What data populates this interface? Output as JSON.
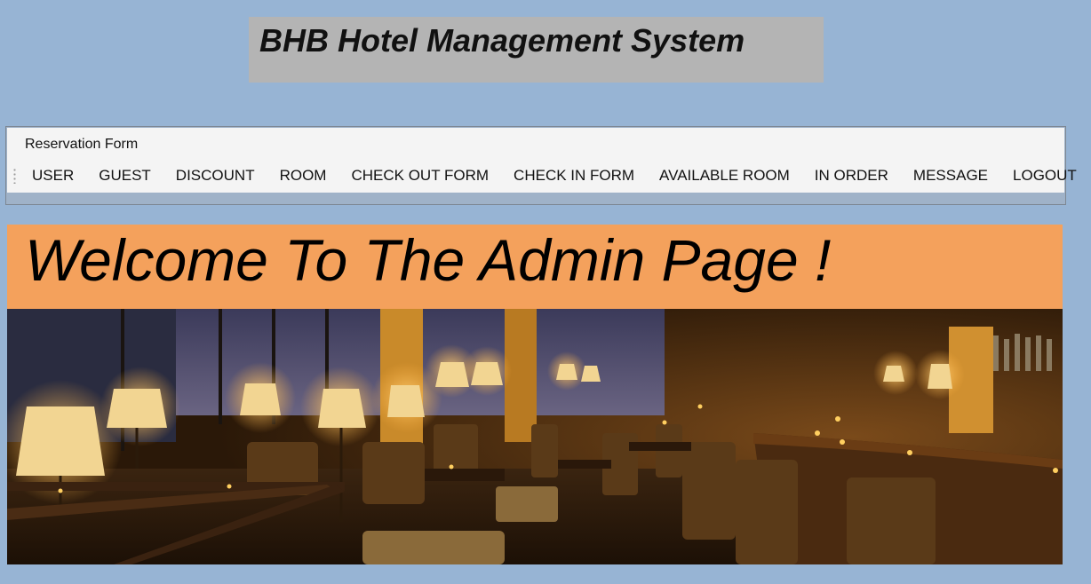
{
  "app": {
    "title": "BHB Hotel Management System"
  },
  "form": {
    "label": "Reservation Form"
  },
  "menu": {
    "items": [
      {
        "label": "USER",
        "name": "menu-user"
      },
      {
        "label": "GUEST",
        "name": "menu-guest"
      },
      {
        "label": "DISCOUNT",
        "name": "menu-discount"
      },
      {
        "label": "ROOM",
        "name": "menu-room"
      },
      {
        "label": "CHECK OUT FORM",
        "name": "menu-check-out-form"
      },
      {
        "label": "CHECK IN FORM",
        "name": "menu-check-in-form"
      },
      {
        "label": "AVAILABLE ROOM",
        "name": "menu-available-room"
      },
      {
        "label": "IN ORDER",
        "name": "menu-in-order"
      },
      {
        "label": "MESSAGE",
        "name": "menu-message"
      },
      {
        "label": "LOGOUT",
        "name": "menu-logout"
      }
    ]
  },
  "welcome": {
    "text": "Welcome To The Admin Page !"
  },
  "colors": {
    "background": "#97b4d4",
    "title_box": "#b4b4b4",
    "banner": "#f4a15c",
    "menu_strip": "#f4f4f4"
  }
}
